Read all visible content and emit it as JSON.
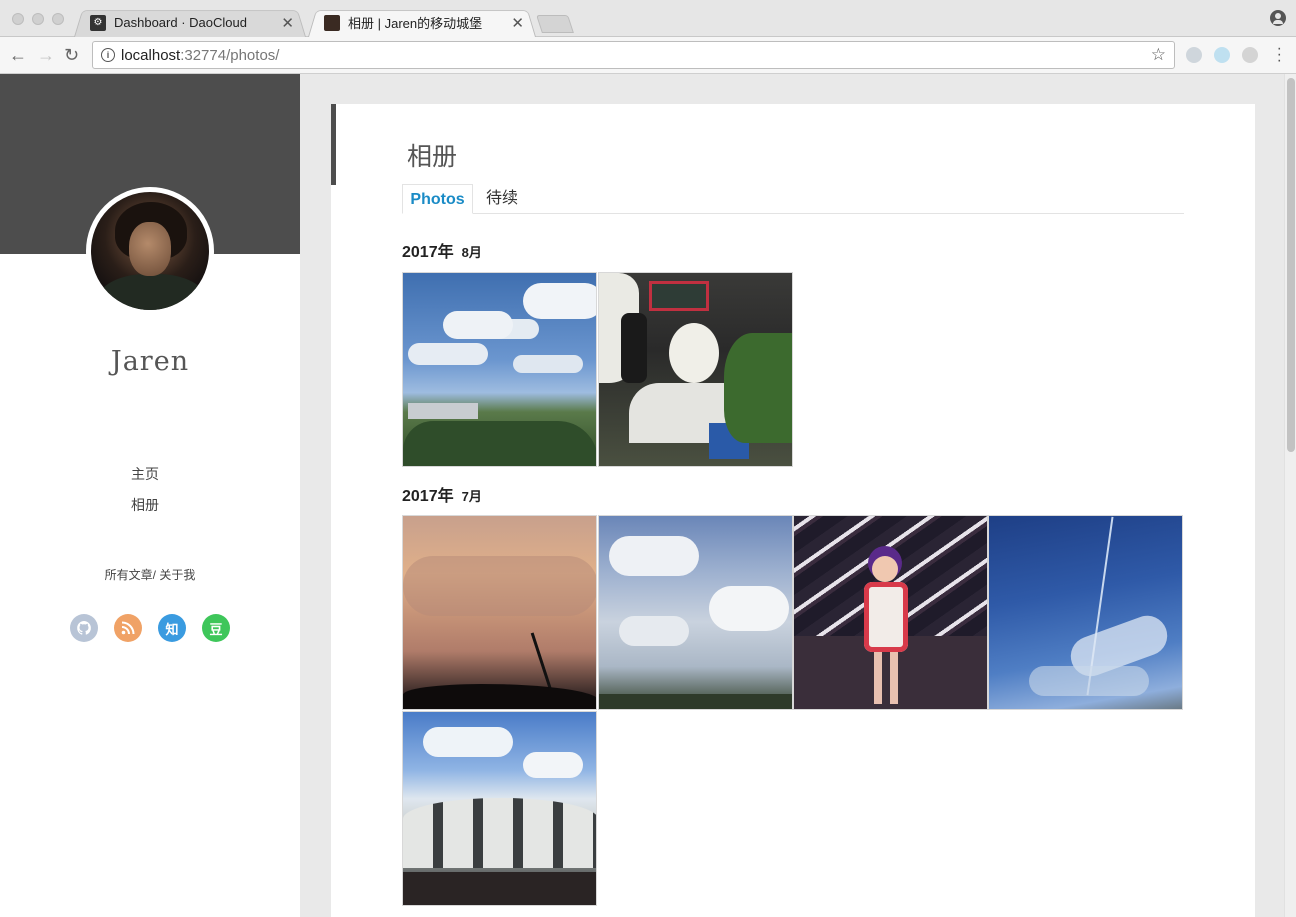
{
  "browser": {
    "tabs": [
      {
        "title": "Dashboard · DaoCloud",
        "active": false
      },
      {
        "title": "相册 | Jaren的移动城堡",
        "active": true
      }
    ],
    "url_host": "localhost",
    "url_rest": ":32774/photos/"
  },
  "sidebar": {
    "author": "Jaren",
    "nav": [
      "主页",
      "相册"
    ],
    "links": "所有文章/ 关于我",
    "social": [
      {
        "icon": "github-icon",
        "color": "#b8c4d6",
        "label": ""
      },
      {
        "icon": "rss-icon",
        "color": "#f0a266",
        "label": ""
      },
      {
        "icon": "zhihu-icon",
        "color": "#3a9be0",
        "label": "知"
      },
      {
        "icon": "douban-icon",
        "color": "#3ec65a",
        "label": "豆"
      }
    ]
  },
  "main": {
    "title": "相册",
    "tabs": [
      "Photos",
      "待续"
    ],
    "groups": [
      {
        "year": "2017年",
        "month": "8月",
        "photos": 2
      },
      {
        "year": "2017年",
        "month": "7月",
        "photos": 5
      }
    ]
  }
}
